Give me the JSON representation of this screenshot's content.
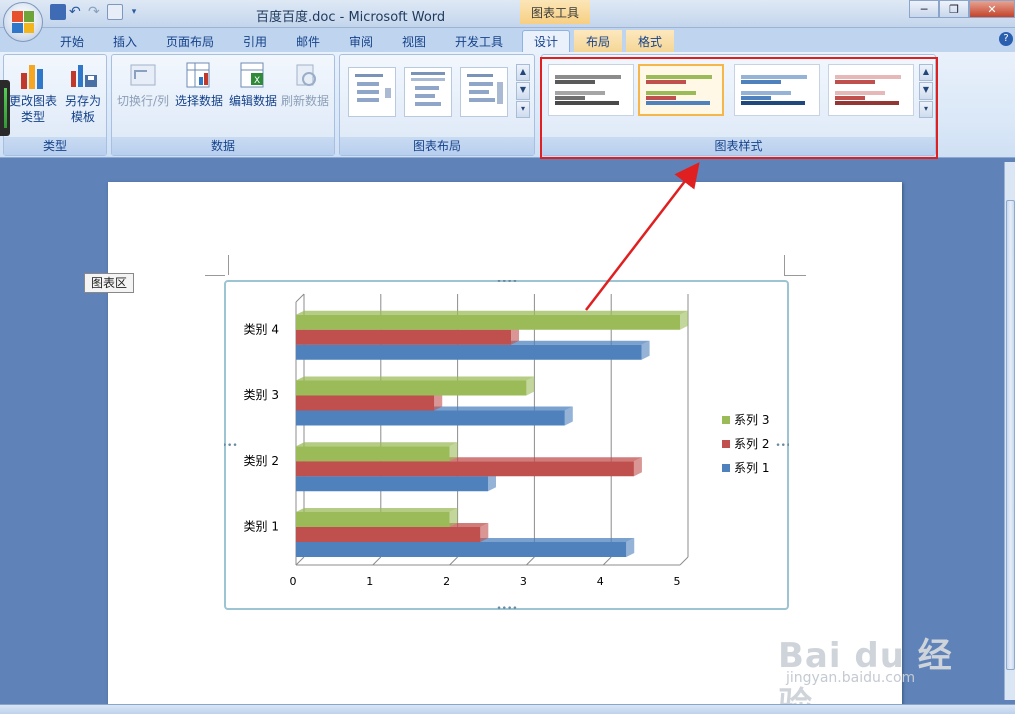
{
  "window": {
    "doc_title": "百度百度.doc - Microsoft Word",
    "context_title": "图表工具",
    "minimize": "─",
    "maximize": "❐",
    "close": "✕"
  },
  "tabs": [
    {
      "label": "开始"
    },
    {
      "label": "插入"
    },
    {
      "label": "页面布局"
    },
    {
      "label": "引用"
    },
    {
      "label": "邮件"
    },
    {
      "label": "审阅"
    },
    {
      "label": "视图"
    },
    {
      "label": "开发工具"
    },
    {
      "label": "设计"
    },
    {
      "label": "布局"
    },
    {
      "label": "格式"
    }
  ],
  "ribbon": {
    "type_group": {
      "label": "类型",
      "change_type": "更改图表类型",
      "save_template": "另存为模板"
    },
    "data_group": {
      "label": "数据",
      "switch_row_col": "切换行/列",
      "select_data": "选择数据",
      "edit_data": "编辑数据",
      "refresh_data": "刷新数据"
    },
    "layout_group": {
      "label": "图表布局"
    },
    "style_group": {
      "label": "图表样式"
    }
  },
  "document": {
    "tooltip": "图表区"
  },
  "chart_data": {
    "type": "bar",
    "orientation": "horizontal",
    "categories": [
      "类别 1",
      "类别 2",
      "类别 3",
      "类别 4"
    ],
    "series": [
      {
        "name": "系列 1",
        "values": [
          4.3,
          2.5,
          3.5,
          4.5
        ],
        "color": "#4f81bd"
      },
      {
        "name": "系列 2",
        "values": [
          2.4,
          4.4,
          1.8,
          2.8
        ],
        "color": "#c0504d"
      },
      {
        "name": "系列 3",
        "values": [
          2,
          2,
          3,
          5
        ],
        "color": "#9bbb59"
      }
    ],
    "xlim": [
      0,
      5
    ],
    "xticks": [
      "0",
      "1",
      "2",
      "3",
      "4",
      "5"
    ],
    "grid": true,
    "legend": "right"
  },
  "watermark": {
    "main": "Bai du 经验",
    "sub": "jingyan.baidu.com"
  }
}
